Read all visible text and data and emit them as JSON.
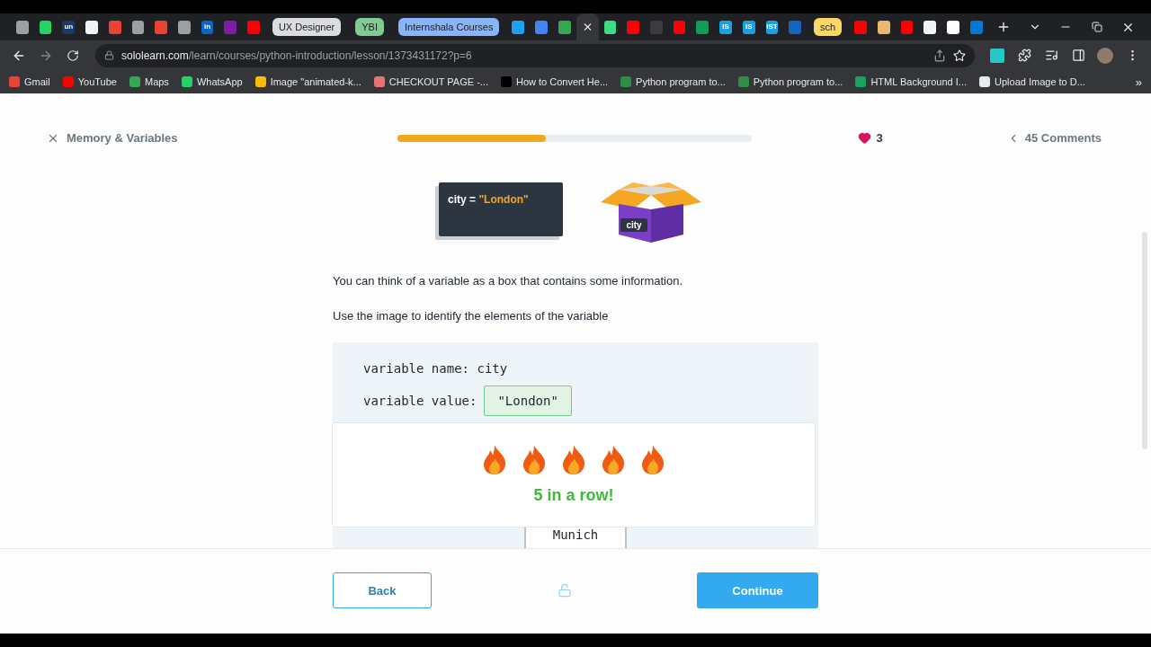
{
  "tabs": [
    {
      "kind": "favicon",
      "color": "#9aa0a6",
      "selected": false
    },
    {
      "kind": "favicon",
      "color": "#25d366",
      "selected": false
    },
    {
      "kind": "favicon",
      "color": "#1a3a6b",
      "label": "un",
      "selected": false
    },
    {
      "kind": "favicon",
      "color": "#f1f3f4",
      "selected": false
    },
    {
      "kind": "favicon",
      "color": "#ea4335",
      "selected": false
    },
    {
      "kind": "favicon",
      "color": "#9aa0a6",
      "selected": false
    },
    {
      "kind": "favicon",
      "color": "#ea4335",
      "selected": false
    },
    {
      "kind": "favicon",
      "color": "#9aa0a6",
      "selected": false
    },
    {
      "kind": "favicon",
      "color": "#0a66c2",
      "label": "in",
      "selected": false
    },
    {
      "kind": "favicon",
      "color": "#7b1fa2",
      "selected": false
    },
    {
      "kind": "favicon",
      "color": "#ff0000",
      "selected": false
    },
    {
      "kind": "group",
      "color": "#dadce0",
      "label": "UX Designer",
      "selected": false
    },
    {
      "kind": "group",
      "color": "#81c995",
      "label": "YBI",
      "selected": false
    },
    {
      "kind": "group",
      "color": "#8ab4f8",
      "label": "Internshala Courses",
      "selected": false
    },
    {
      "kind": "favicon",
      "color": "#1da1f2",
      "selected": false
    },
    {
      "kind": "favicon",
      "color": "#4285f4",
      "selected": false
    },
    {
      "kind": "favicon",
      "color": "#34a853",
      "selected": false
    },
    {
      "kind": "favicon",
      "selected": true
    },
    {
      "kind": "favicon",
      "color": "#3ddc84",
      "selected": false
    },
    {
      "kind": "favicon",
      "color": "#ff0000",
      "selected": false
    },
    {
      "kind": "favicon",
      "color": "#3c3c3c",
      "selected": false
    },
    {
      "kind": "favicon",
      "color": "#ff0000",
      "selected": false
    },
    {
      "kind": "favicon",
      "color": "#0f9d58",
      "selected": false
    },
    {
      "kind": "favicon",
      "color": "#1ba1e2",
      "label": "IS",
      "selected": false
    },
    {
      "kind": "favicon",
      "color": "#1ba1e2",
      "label": "IS",
      "selected": false
    },
    {
      "kind": "favicon",
      "color": "#1ba1e2",
      "label": "IST",
      "selected": false
    },
    {
      "kind": "favicon",
      "color": "#1565c0",
      "selected": false
    },
    {
      "kind": "group",
      "color": "#fdd663",
      "label": "sch",
      "selected": false
    },
    {
      "kind": "favicon",
      "color": "#ff0000",
      "selected": false
    },
    {
      "kind": "favicon",
      "color": "#e8b86d",
      "selected": false
    },
    {
      "kind": "favicon",
      "color": "#ff0000",
      "selected": false
    },
    {
      "kind": "favicon",
      "color": "#f1f3f4",
      "selected": false
    },
    {
      "kind": "favicon",
      "color": "#ffffff",
      "selected": false
    },
    {
      "kind": "favicon",
      "color": "#0078d4",
      "selected": false
    }
  ],
  "address": {
    "host": "sololearn.com",
    "path": "/learn/courses/python-introduction/lesson/1373431172?p=6"
  },
  "bookmarks": [
    {
      "label": "Gmail",
      "color": "#ea4335"
    },
    {
      "label": "YouTube",
      "color": "#ff0000"
    },
    {
      "label": "Maps",
      "color": "#34a853"
    },
    {
      "label": "WhatsApp",
      "color": "#25d366"
    },
    {
      "label": "Image \"animated-k...",
      "color": "#fbbc04"
    },
    {
      "label": "CHECKOUT PAGE -...",
      "color": "#e57373"
    },
    {
      "label": "How to Convert He...",
      "color": "#000000"
    },
    {
      "label": "Python program to...",
      "color": "#2f8d46"
    },
    {
      "label": "Python program to...",
      "color": "#2f8d46"
    },
    {
      "label": "HTML Background I...",
      "color": "#1aa260"
    },
    {
      "label": "Upload Image to D...",
      "color": "#e8eaed"
    }
  ],
  "bookmarks_more": "»",
  "lesson": {
    "title": "Memory & Variables",
    "progress": {
      "level": 0.42
    },
    "lives": "3",
    "comments": "45 Comments"
  },
  "illustration": {
    "code_name": "city",
    "code_equals": "=",
    "code_value": "\"London\"",
    "box_label": "city"
  },
  "paragraphs": [
    "You can think of a variable as a box that contains some information.",
    "Use the image to identify the elements of the variable"
  ],
  "code_lines": [
    {
      "label": "variable name:",
      "value": "city",
      "kind": "plain"
    },
    {
      "label": "variable value:",
      "value": "\"London\"",
      "kind": "filled"
    }
  ],
  "options": [
    "Munich"
  ],
  "streak": {
    "message": "5 in a row!"
  },
  "footer": {
    "back": "Back",
    "continue": "Continue",
    "locked": false
  }
}
